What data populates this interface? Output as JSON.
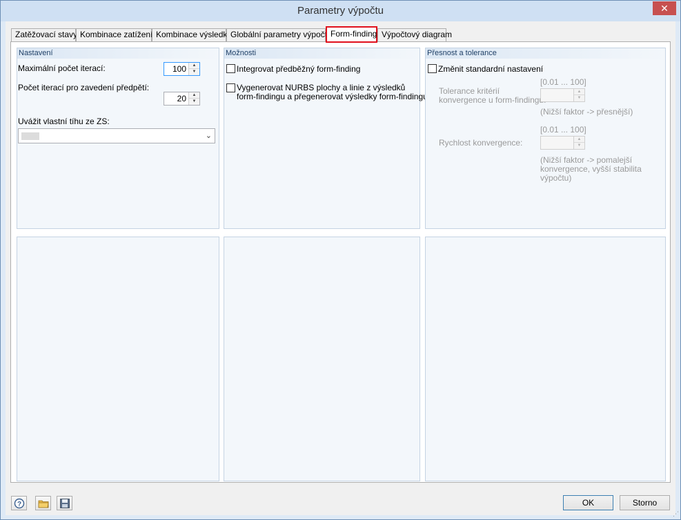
{
  "window": {
    "title": "Parametry výpočtu",
    "close_glyph": "✕"
  },
  "tabs": [
    {
      "label": "Zatěžovací stavy"
    },
    {
      "label": "Kombinace zatížení"
    },
    {
      "label": "Kombinace výsledků"
    },
    {
      "label": "Globální parametry výpočtu"
    },
    {
      "label": "Form-finding"
    },
    {
      "label": "Výpočtový diagram"
    }
  ],
  "active_tab": "Form-finding",
  "settings": {
    "header": "Nastavení",
    "max_iterations_label": "Maximální počet iterací:",
    "max_iterations_value": "100",
    "prestress_iterations_label": "Počet iterací pro zavedení předpětí:",
    "prestress_iterations_value": "20",
    "self_weight_label": "Uvážit vlastní tíhu ze ZS:",
    "self_weight_value": ""
  },
  "options": {
    "header": "Možnosti",
    "integrate_label": "Integrovat předběžný form-finding",
    "integrate_checked": false,
    "nurbs_line1": "Vygenerovat NURBS plochy a linie z výsledků",
    "nurbs_line2": "form-findingu a přegenerovat výsledky form-findingu",
    "nurbs_checked": false
  },
  "precision": {
    "header": "Přesnost a tolerance",
    "change_defaults_label": "Změnit standardní nastavení",
    "change_defaults_checked": false,
    "tolerance_range": "[0.01 ... 100]",
    "tolerance_label1": "Tolerance kritérií",
    "tolerance_label2": "konvergence u form-findingu:",
    "tolerance_value": "",
    "tolerance_hint": "(Nižší faktor -> přesnější)",
    "speed_range": "[0.01 ... 100]",
    "speed_label": "Rychlost konvergence:",
    "speed_value": "",
    "speed_hint1": "(Nižší faktor -> pomalejší",
    "speed_hint2": "konvergence, vyšší stabilita",
    "speed_hint3": "výpočtu)"
  },
  "footer": {
    "ok_label": "OK",
    "cancel_label": "Storno",
    "icons": [
      "help-icon",
      "open-folder-icon",
      "save-icon"
    ]
  }
}
